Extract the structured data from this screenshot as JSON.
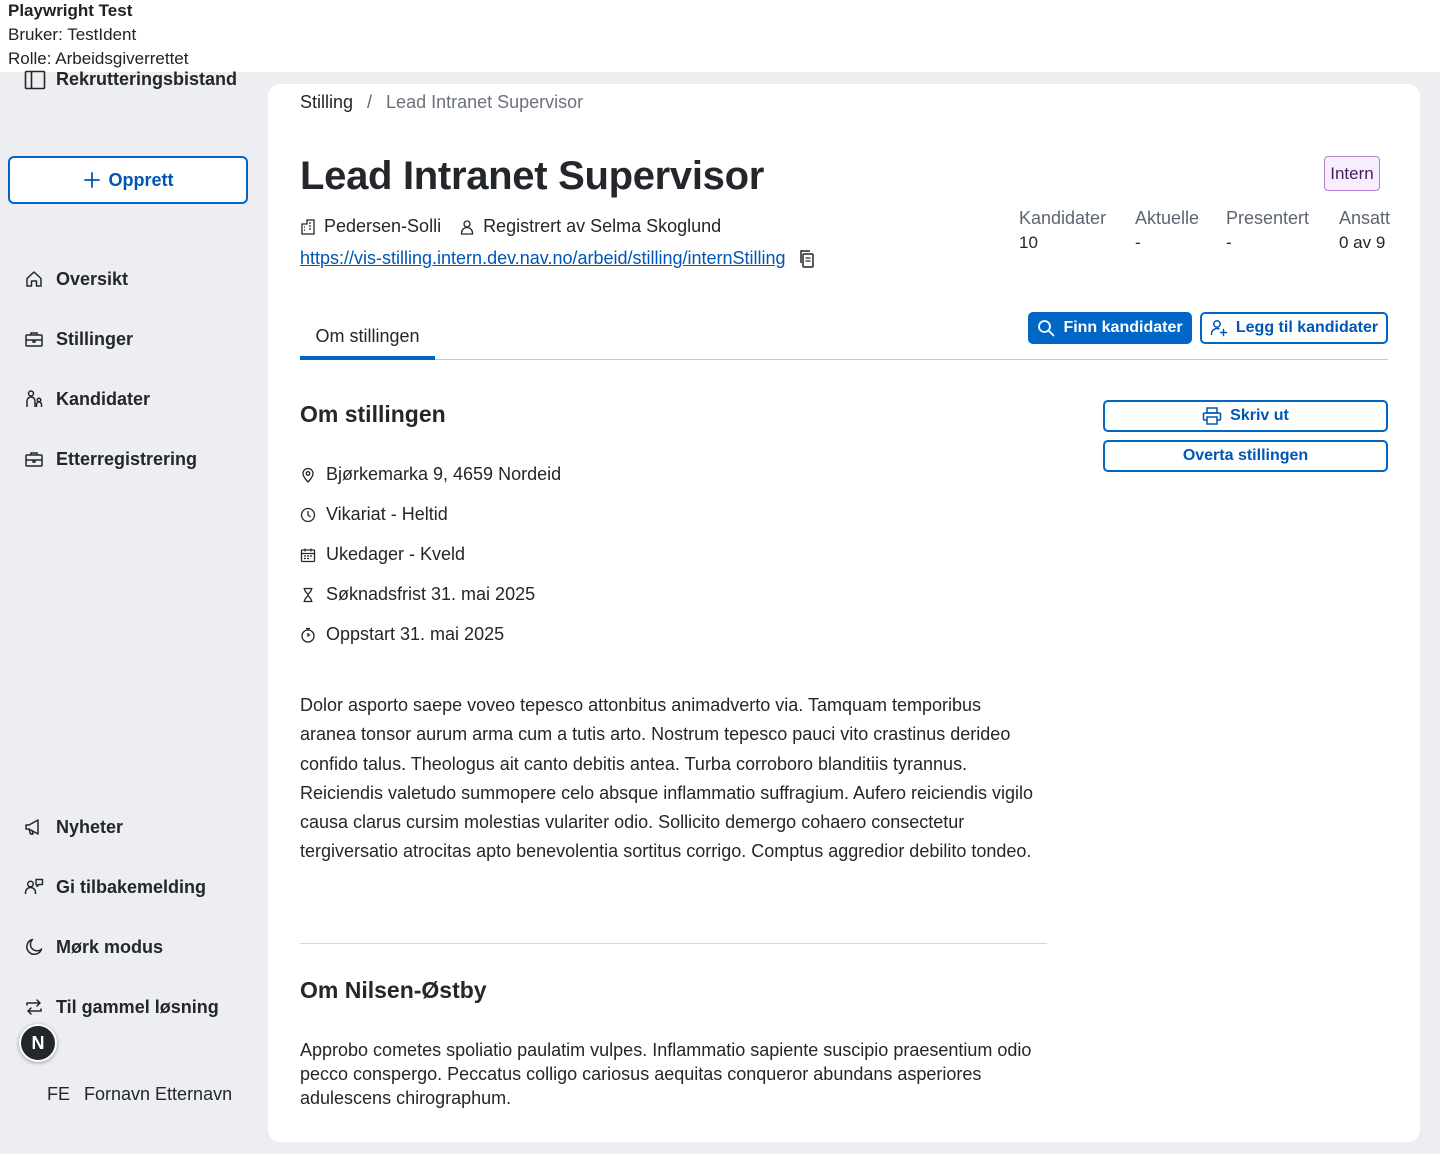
{
  "debug": {
    "title": "Playwright Test",
    "user_line": "Bruker: TestIdent",
    "role_line": "Rolle: Arbeidsgiverrettet"
  },
  "sidebar": {
    "brand": "Rekrutteringsbistand",
    "create_label": "Opprett",
    "nav": [
      {
        "label": "Oversikt",
        "icon": "home-icon"
      },
      {
        "label": "Stillinger",
        "icon": "briefcase-icon"
      },
      {
        "label": "Kandidater",
        "icon": "person-child-icon"
      },
      {
        "label": "Etterregistrering",
        "icon": "briefcase-icon"
      }
    ],
    "bottom_nav": [
      {
        "label": "Nyheter",
        "icon": "megaphone-icon"
      },
      {
        "label": "Gi tilbakemelding",
        "icon": "feedback-icon"
      },
      {
        "label": "Mørk modus",
        "icon": "moon-icon"
      },
      {
        "label": "Til gammel løsning",
        "icon": "swap-arrows-icon"
      }
    ],
    "fab_letter": "N",
    "user_initials": "FE",
    "user_name": "Fornavn Etternavn"
  },
  "breadcrumb": {
    "root": "Stilling",
    "separator": "/",
    "current": "Lead Intranet Supervisor"
  },
  "job": {
    "title": "Lead Intranet Supervisor",
    "tag": "Intern",
    "employer": "Pedersen-Solli",
    "registered_by": "Registrert av Selma Skoglund",
    "url": "https://vis-stilling.intern.dev.nav.no/arbeid/stilling/internStilling"
  },
  "stats": [
    {
      "label": "Kandidater",
      "value": "10"
    },
    {
      "label": "Aktuelle",
      "value": "-"
    },
    {
      "label": "Presentert",
      "value": "-"
    },
    {
      "label": "Ansatt",
      "value": "0 av 9"
    }
  ],
  "tabs": {
    "active": "Om stillingen"
  },
  "actions": {
    "find_candidates": "Finn kandidater",
    "add_candidates": "Legg til kandidater",
    "print": "Skriv ut",
    "take_over": "Overta stillingen"
  },
  "about": {
    "heading": "Om stillingen",
    "details": [
      {
        "text": "Bjørkemarka 9, 4659 Nordeid",
        "icon": "location-pin-icon"
      },
      {
        "text": "Vikariat - Heltid",
        "icon": "clock-icon"
      },
      {
        "text": "Ukedager - Kveld",
        "icon": "calendar-icon"
      },
      {
        "text": "Søknadsfrist 31. mai 2025",
        "icon": "hourglass-icon"
      },
      {
        "text": "Oppstart 31. mai 2025",
        "icon": "stopwatch-icon"
      }
    ],
    "description": "Dolor asporto saepe voveo tepesco attonbitus animadverto via. Tamquam temporibus aranea tonsor aurum arma cum a tutis arto. Nostrum tepesco pauci vito crastinus derideo confido talus. Theologus ait canto debitis antea. Turba corroboro blanditiis tyrannus. Reiciendis valetudo summopere celo absque inflammatio suffragium. Aufero reiciendis vigilo causa clarus cursim molestias vulariter odio. Sollicito demergo cohaero consectetur tergiversatio atrocitas apto benevolentia sortitus corrigo. Comptus aggredior debilito tondeo."
  },
  "company": {
    "heading": "Om Nilsen-Østby",
    "description": "Approbo cometes spoliatio paulatim vulpes. Inflammatio sapiente suscipio praesentium odio pecco conspergo. Peccatus colligo cariosus aequitas conqueror abundans asperiores adulescens chirographum."
  },
  "colors": {
    "accent": "#0067c5",
    "link": "#0056b4",
    "tag_bg": "#f6eefc",
    "tag_border": "#b87fd6",
    "sidebar_bg": "#eceef1"
  }
}
